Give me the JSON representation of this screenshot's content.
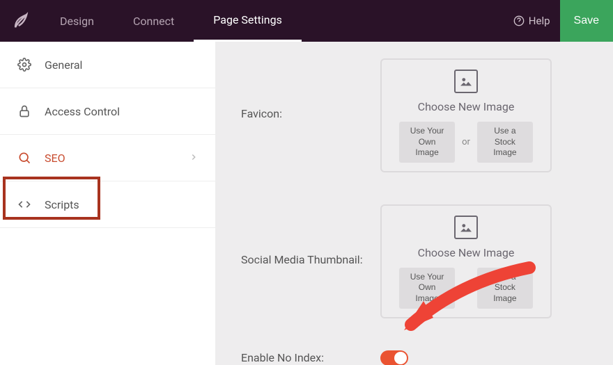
{
  "header": {
    "nav": [
      {
        "label": "Design"
      },
      {
        "label": "Connect"
      },
      {
        "label": "Page Settings"
      }
    ],
    "help_label": "Help",
    "save_label": "Save"
  },
  "sidebar": {
    "items": [
      {
        "label": "General"
      },
      {
        "label": "Access Control"
      },
      {
        "label": "SEO"
      },
      {
        "label": "Scripts"
      }
    ]
  },
  "content": {
    "favicon_label": "Favicon:",
    "social_label": "Social Media Thumbnail:",
    "choose_label": "Choose New Image",
    "own_image_btn": "Use Your Own Image",
    "stock_image_btn": "Use a Stock Image",
    "or_label": "or",
    "noindex_label": "Enable No Index:"
  }
}
